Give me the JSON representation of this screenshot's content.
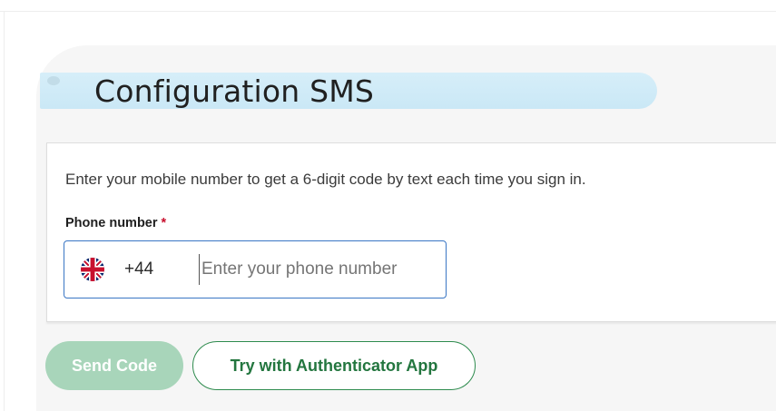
{
  "header": {
    "title": "Configuration SMS"
  },
  "card": {
    "description": "Enter your mobile number to get a 6-digit code by text each time you sign in.",
    "phone_label": "Phone number",
    "required_marker": "*",
    "country_flag_icon": "uk-flag-icon",
    "country_code": "+44",
    "phone_value": "",
    "phone_placeholder": "Enter your phone number"
  },
  "actions": {
    "send_code_label": "Send Code",
    "send_code_disabled": true,
    "authenticator_label": "Try with Authenticator App"
  },
  "colors": {
    "title_highlight": "#cae8f6",
    "input_focus_border": "#3a76c4",
    "required": "#c8102e",
    "primary_disabled": "#a8d5ba",
    "secondary_text": "#23763f",
    "secondary_border": "#2e8b4e"
  }
}
